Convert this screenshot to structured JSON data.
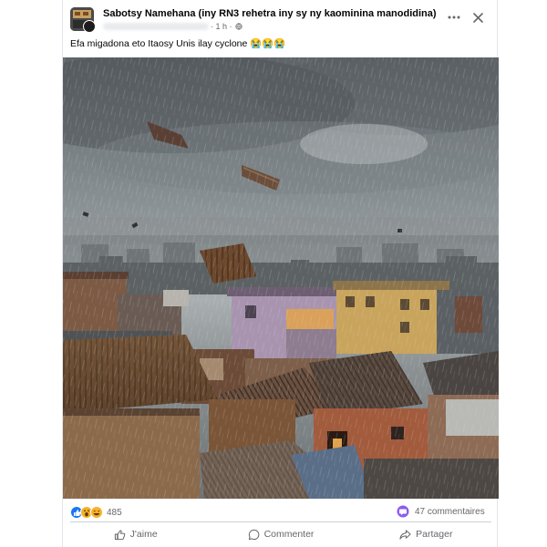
{
  "post": {
    "group_name": "Sabotsy Namehana (iny RN3 rehetra iny sy ny kaominina manodidina)",
    "time": "· 1 h ·",
    "text": "Efa migadona eto Itaosy Unis ilay cyclone 😭😭😭",
    "photo_icon": "image-storm-rooftops"
  },
  "reactions": {
    "count": "485",
    "icons": [
      "like-icon",
      "wow-icon",
      "haha-icon"
    ]
  },
  "comments": {
    "count_label": "47 commentaires"
  },
  "actions": {
    "like": "J'aime",
    "comment": "Commenter",
    "share": "Partager"
  },
  "colors": {
    "like_blue": "#1877f2",
    "muted": "#65676b",
    "comment_purple": "#8a5cf6"
  }
}
